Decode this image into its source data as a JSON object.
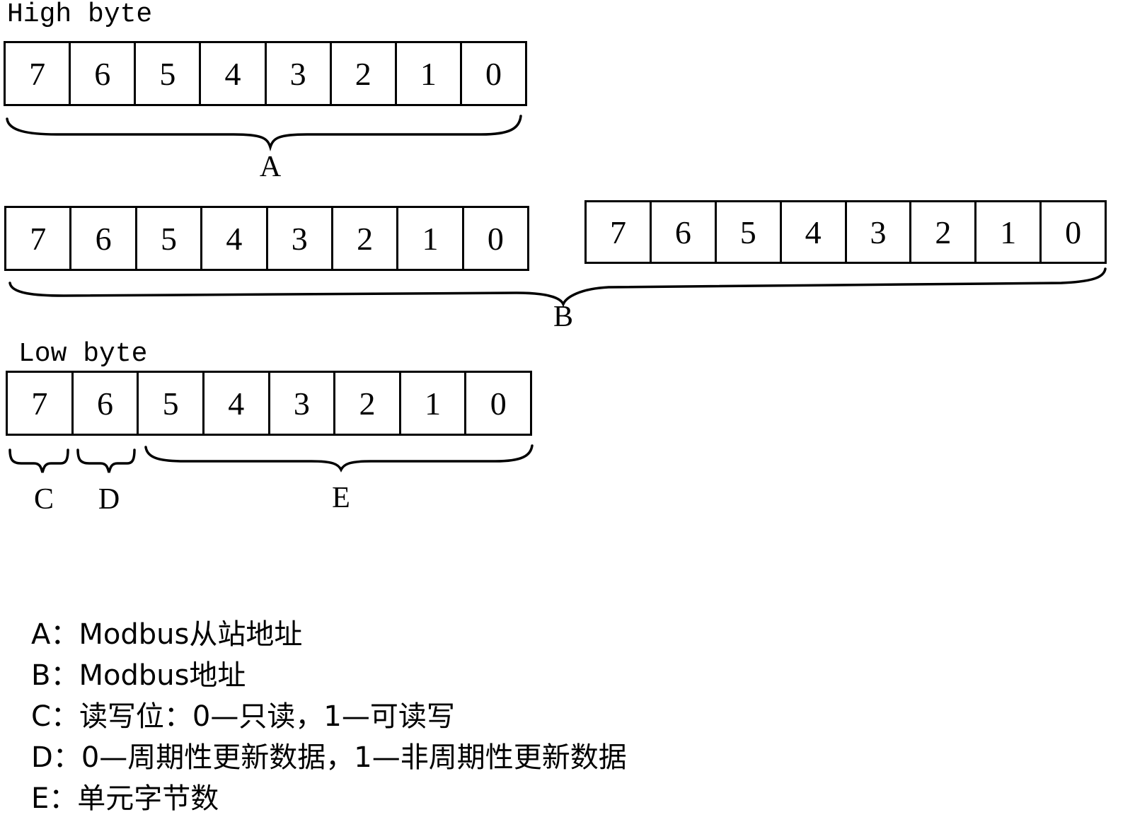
{
  "high_byte": {
    "title": "High byte",
    "bits": [
      "7",
      "6",
      "5",
      "4",
      "3",
      "2",
      "1",
      "0"
    ],
    "brace_label": "A"
  },
  "modbus_address": {
    "register_1_bits": [
      "7",
      "6",
      "5",
      "4",
      "3",
      "2",
      "1",
      "0"
    ],
    "register_2_bits": [
      "7",
      "6",
      "5",
      "4",
      "3",
      "2",
      "1",
      "0"
    ],
    "brace_label": "B"
  },
  "low_byte": {
    "title": "Low byte",
    "bits": [
      "7",
      "6",
      "5",
      "4",
      "3",
      "2",
      "1",
      "0"
    ],
    "brace_labels": {
      "c": "C",
      "d": "D",
      "e": "E"
    }
  },
  "legend": [
    {
      "key": "A：",
      "text": "Modbus从站地址"
    },
    {
      "key": "B：",
      "text": "Modbus地址"
    },
    {
      "key": "C：",
      "text": "读写位：0—只读，1—可读写"
    },
    {
      "key": "D：",
      "text": "0—周期性更新数据，1—非周期性更新数据"
    },
    {
      "key": "E：",
      "text": "单元字节数"
    }
  ]
}
